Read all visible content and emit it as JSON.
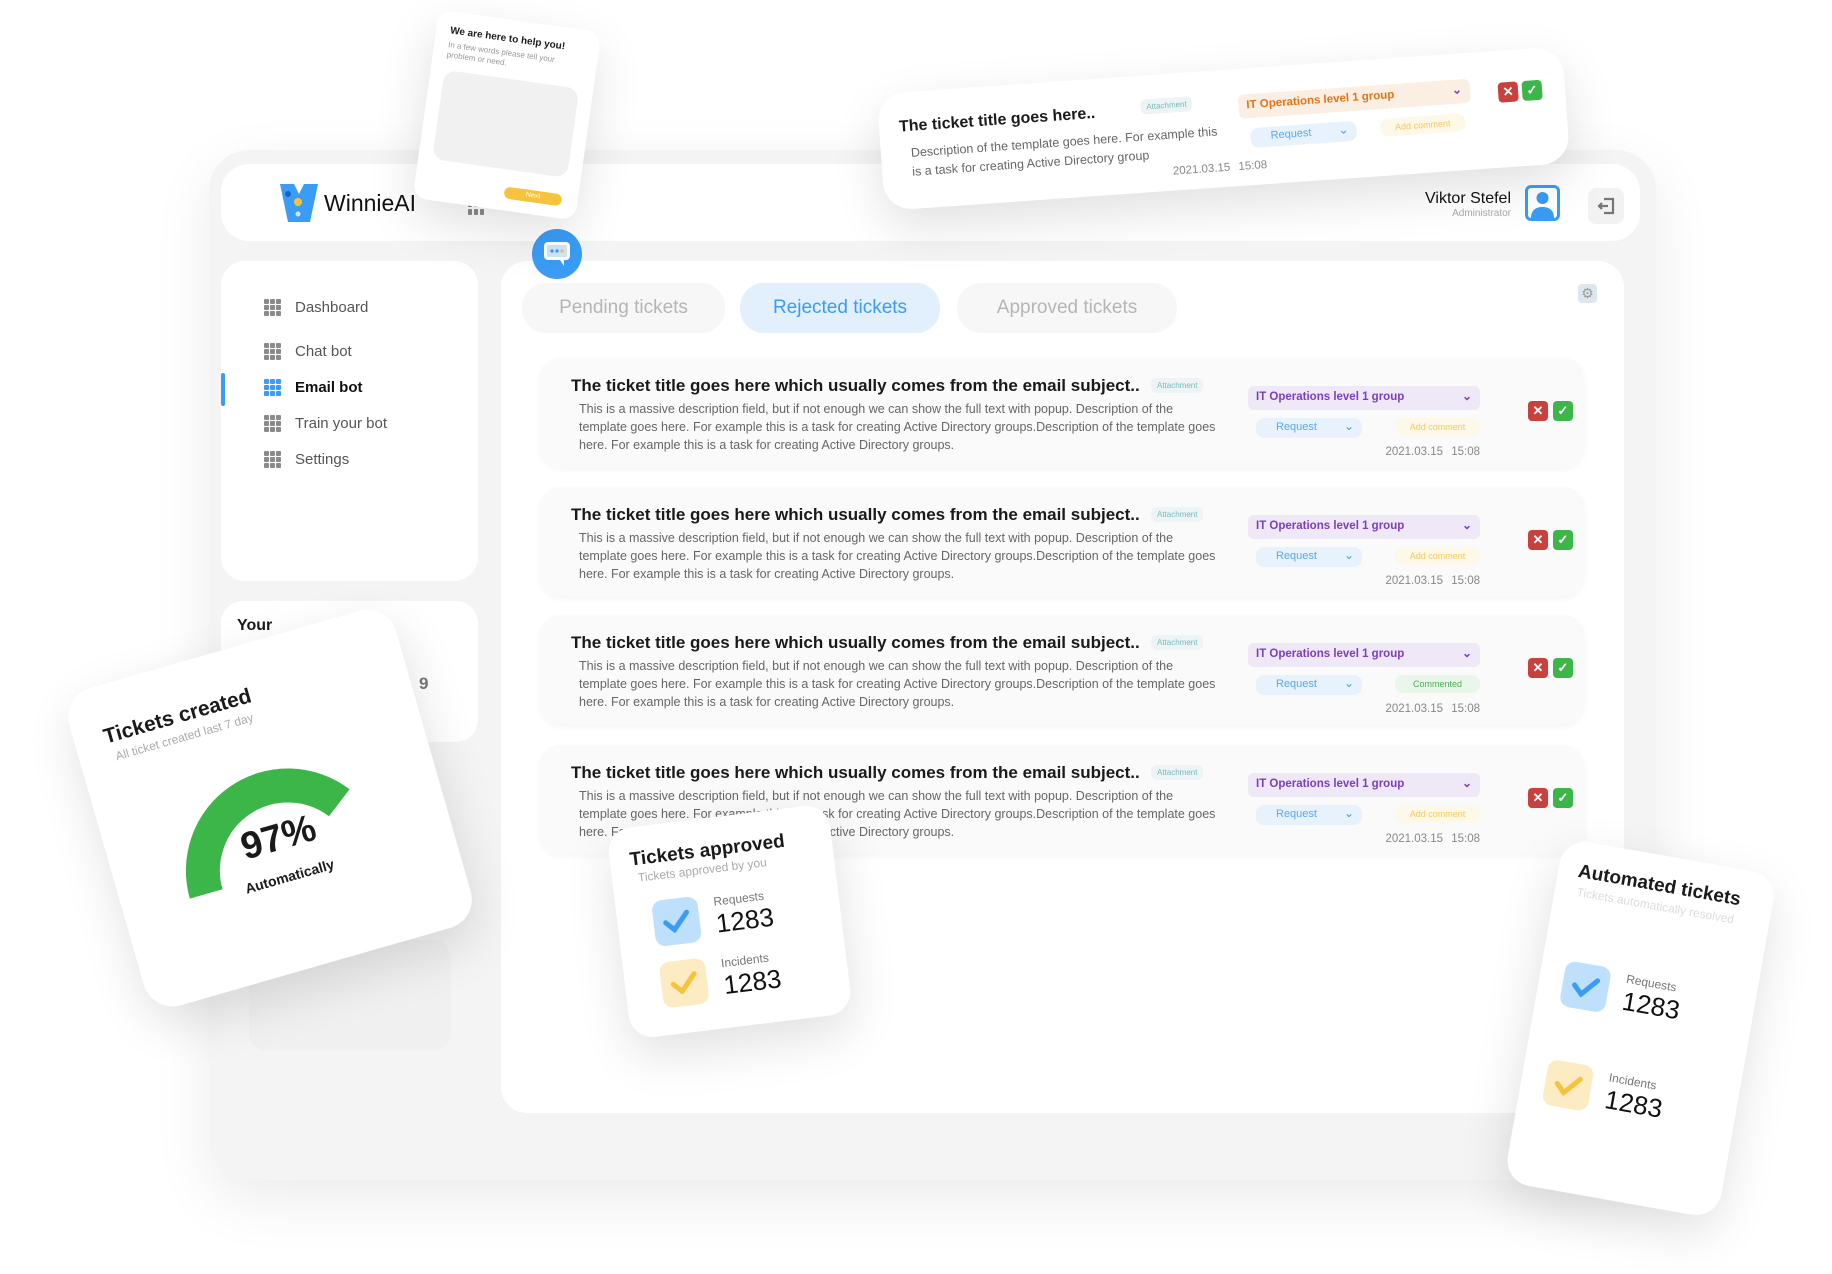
{
  "app": {
    "brand": "WinnieAI",
    "accent": "#3a9cf5"
  },
  "user": {
    "name": "Viktor Stefel",
    "role": "Administrator"
  },
  "sidebar": {
    "items": [
      {
        "label": "Dashboard",
        "active": false
      },
      {
        "label": "Chat bot",
        "active": false
      },
      {
        "label": "Email bot",
        "active": true
      },
      {
        "label": "Train your  bot",
        "active": false
      },
      {
        "label": "Settings",
        "active": false
      }
    ]
  },
  "your_card": {
    "title": "Your ",
    "value": "9"
  },
  "tabs": [
    {
      "label": "Pending tickets"
    },
    {
      "label": "Rejected tickets",
      "active": true
    },
    {
      "label": "Approved tickets"
    }
  ],
  "tickets": [
    {
      "title": "The ticket title goes here which usually comes from the email subject..",
      "attachment": "Attachment",
      "description": "This is a massive description field, but if not enough we can show the full text with popup. Description of the template goes here. For example this is a task for creating Active Directory groups.Description of the template goes here. For example this is a task for creating Active Directory groups.",
      "group": "IT Operations level 1 group",
      "type": "Request",
      "comment": "Add comment",
      "date": "2021.03.15",
      "time": "15:08"
    },
    {
      "title": "The ticket title goes here which usually comes from the email subject..",
      "attachment": "Attachment",
      "description": "This is a massive description field, but if not enough we can show the full text with popup. Description of the template goes here. For example this is a task for creating Active Directory groups.Description of the template goes here. For example this is a task for creating Active Directory groups.",
      "group": "IT Operations level 1 group",
      "type": "Request",
      "comment": "Add comment",
      "date": "2021.03.15",
      "time": "15:08"
    },
    {
      "title": "The ticket title goes here which usually comes from the email subject..",
      "attachment": "Attachment",
      "description": "This is a massive description field, but if not enough we can show the full text with popup. Description of the template goes here. For example this is a task for creating Active Directory groups.Description of the template goes here. For example this is a task for creating Active Directory groups.",
      "group": "IT Operations level 1 group",
      "type": "Request",
      "comment": "Commented",
      "date": "2021.03.15",
      "time": "15:08"
    },
    {
      "title": "The ticket title goes here which usually comes from the email subject..",
      "attachment": "Attachment",
      "description": "This is a massive description field, but if not enough we can show the full text with popup. Description of the template goes here. For example this is a task for creating Active Directory groups.Description of the template goes here. For example this is a task for creating Active Directory groups.",
      "group": "IT Operations level 1 group",
      "type": "Request",
      "comment": "Add comment",
      "date": "2021.03.15",
      "time": "15:08"
    }
  ],
  "floating_ticket": {
    "title": "The ticket title goes here..",
    "attachment": "Attachment",
    "description": "Description of the template goes here. For example this is a task for creating Active Directory group",
    "group": "IT Operations level 1 group",
    "type": "Request",
    "comment": "Add comment",
    "date": "2021.03.15",
    "time": "15:08"
  },
  "help_popup": {
    "title": "We are here to help you!",
    "subtitle": "In a few words please tell your problem or need.",
    "next": "Next"
  },
  "tickets_created": {
    "title": "Tickets created",
    "subtitle": "All ticket created last 7 day",
    "percent": "97%",
    "percent_value": 97,
    "label": "Automatically",
    "color": "#3cb549"
  },
  "tickets_approved": {
    "title": "Tickets approved",
    "subtitle": "Tickets approved by you",
    "requests_label": "Requests",
    "requests": "1283",
    "incidents_label": "Incidents",
    "incidents": "1283"
  },
  "automated_tickets": {
    "title": "Automated tickets",
    "subtitle": "Tickets automatically resolved",
    "requests_label": "Requests",
    "requests": "1283",
    "incidents_label": "Incidents",
    "incidents": "1283"
  }
}
